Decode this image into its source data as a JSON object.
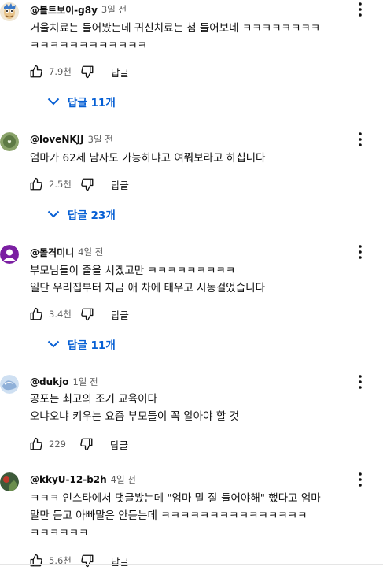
{
  "comments": [
    {
      "author": "@볼트보이-g8y",
      "time": "3일 전",
      "lines": [
        "거울치료는 들어봤는데 귀신치료는 첨 들어보네 ㅋㅋㅋㅋㅋㅋㅋㅋ",
        "ㅋㅋㅋㅋㅋㅋㅋㅋㅋㅋㅋㅋ"
      ],
      "likes": "7.9천",
      "reply_label": "답글",
      "replies": "답글 11개",
      "avatar_color": "#e8dcc4"
    },
    {
      "author": "@loveNKJJ",
      "time": "3일 전",
      "lines": [
        "엄마가 62세 남자도 가능하냐고 여쭤보라고 하십니다"
      ],
      "likes": "2.5천",
      "reply_label": "답글",
      "replies": "답글 23개",
      "avatar_color": "#8aa36a"
    },
    {
      "author": "@돌격미니",
      "time": "4일 전",
      "lines": [
        "부모님들이 줄을 서겠고만 ㅋㅋㅋㅋㅋㅋㅋㅋㅋ",
        "일단 우리집부터 지금 애 차에 태우고 시동걸었습니다"
      ],
      "likes": "3.4천",
      "reply_label": "답글",
      "replies": "답글 11개",
      "avatar_color": "#7b1fa2"
    },
    {
      "author": "@dukjo",
      "time": "1일 전",
      "lines": [
        "공포는 최고의 조기 교육이다",
        "오냐오냐 키우는 요즘 부모들이 꼭 알아야 할 것"
      ],
      "likes": "229",
      "reply_label": "답글",
      "avatar_color": "#8fb0d8"
    },
    {
      "author": "@kkyU-12-b2h",
      "time": "4일 전",
      "lines": [
        "ㅋㅋㅋ 인스타에서 댓글봤는데 \"엄마 말 잘 들어야해\" 했다고 엄마",
        "말만 듣고 아빠말은 안듣는데 ㅋㅋㅋㅋㅋㅋㅋㅋㅋㅋㅋㅋㅋㅋㅋ",
        "ㅋㅋㅋㅋㅋㅋ"
      ],
      "likes": "5.6천",
      "reply_label": "답글",
      "avatar_color": "#3d5a3a"
    }
  ],
  "colors": {
    "text": "#0f0f0f",
    "secondary": "#606060",
    "link_blue": "#065fd4"
  }
}
